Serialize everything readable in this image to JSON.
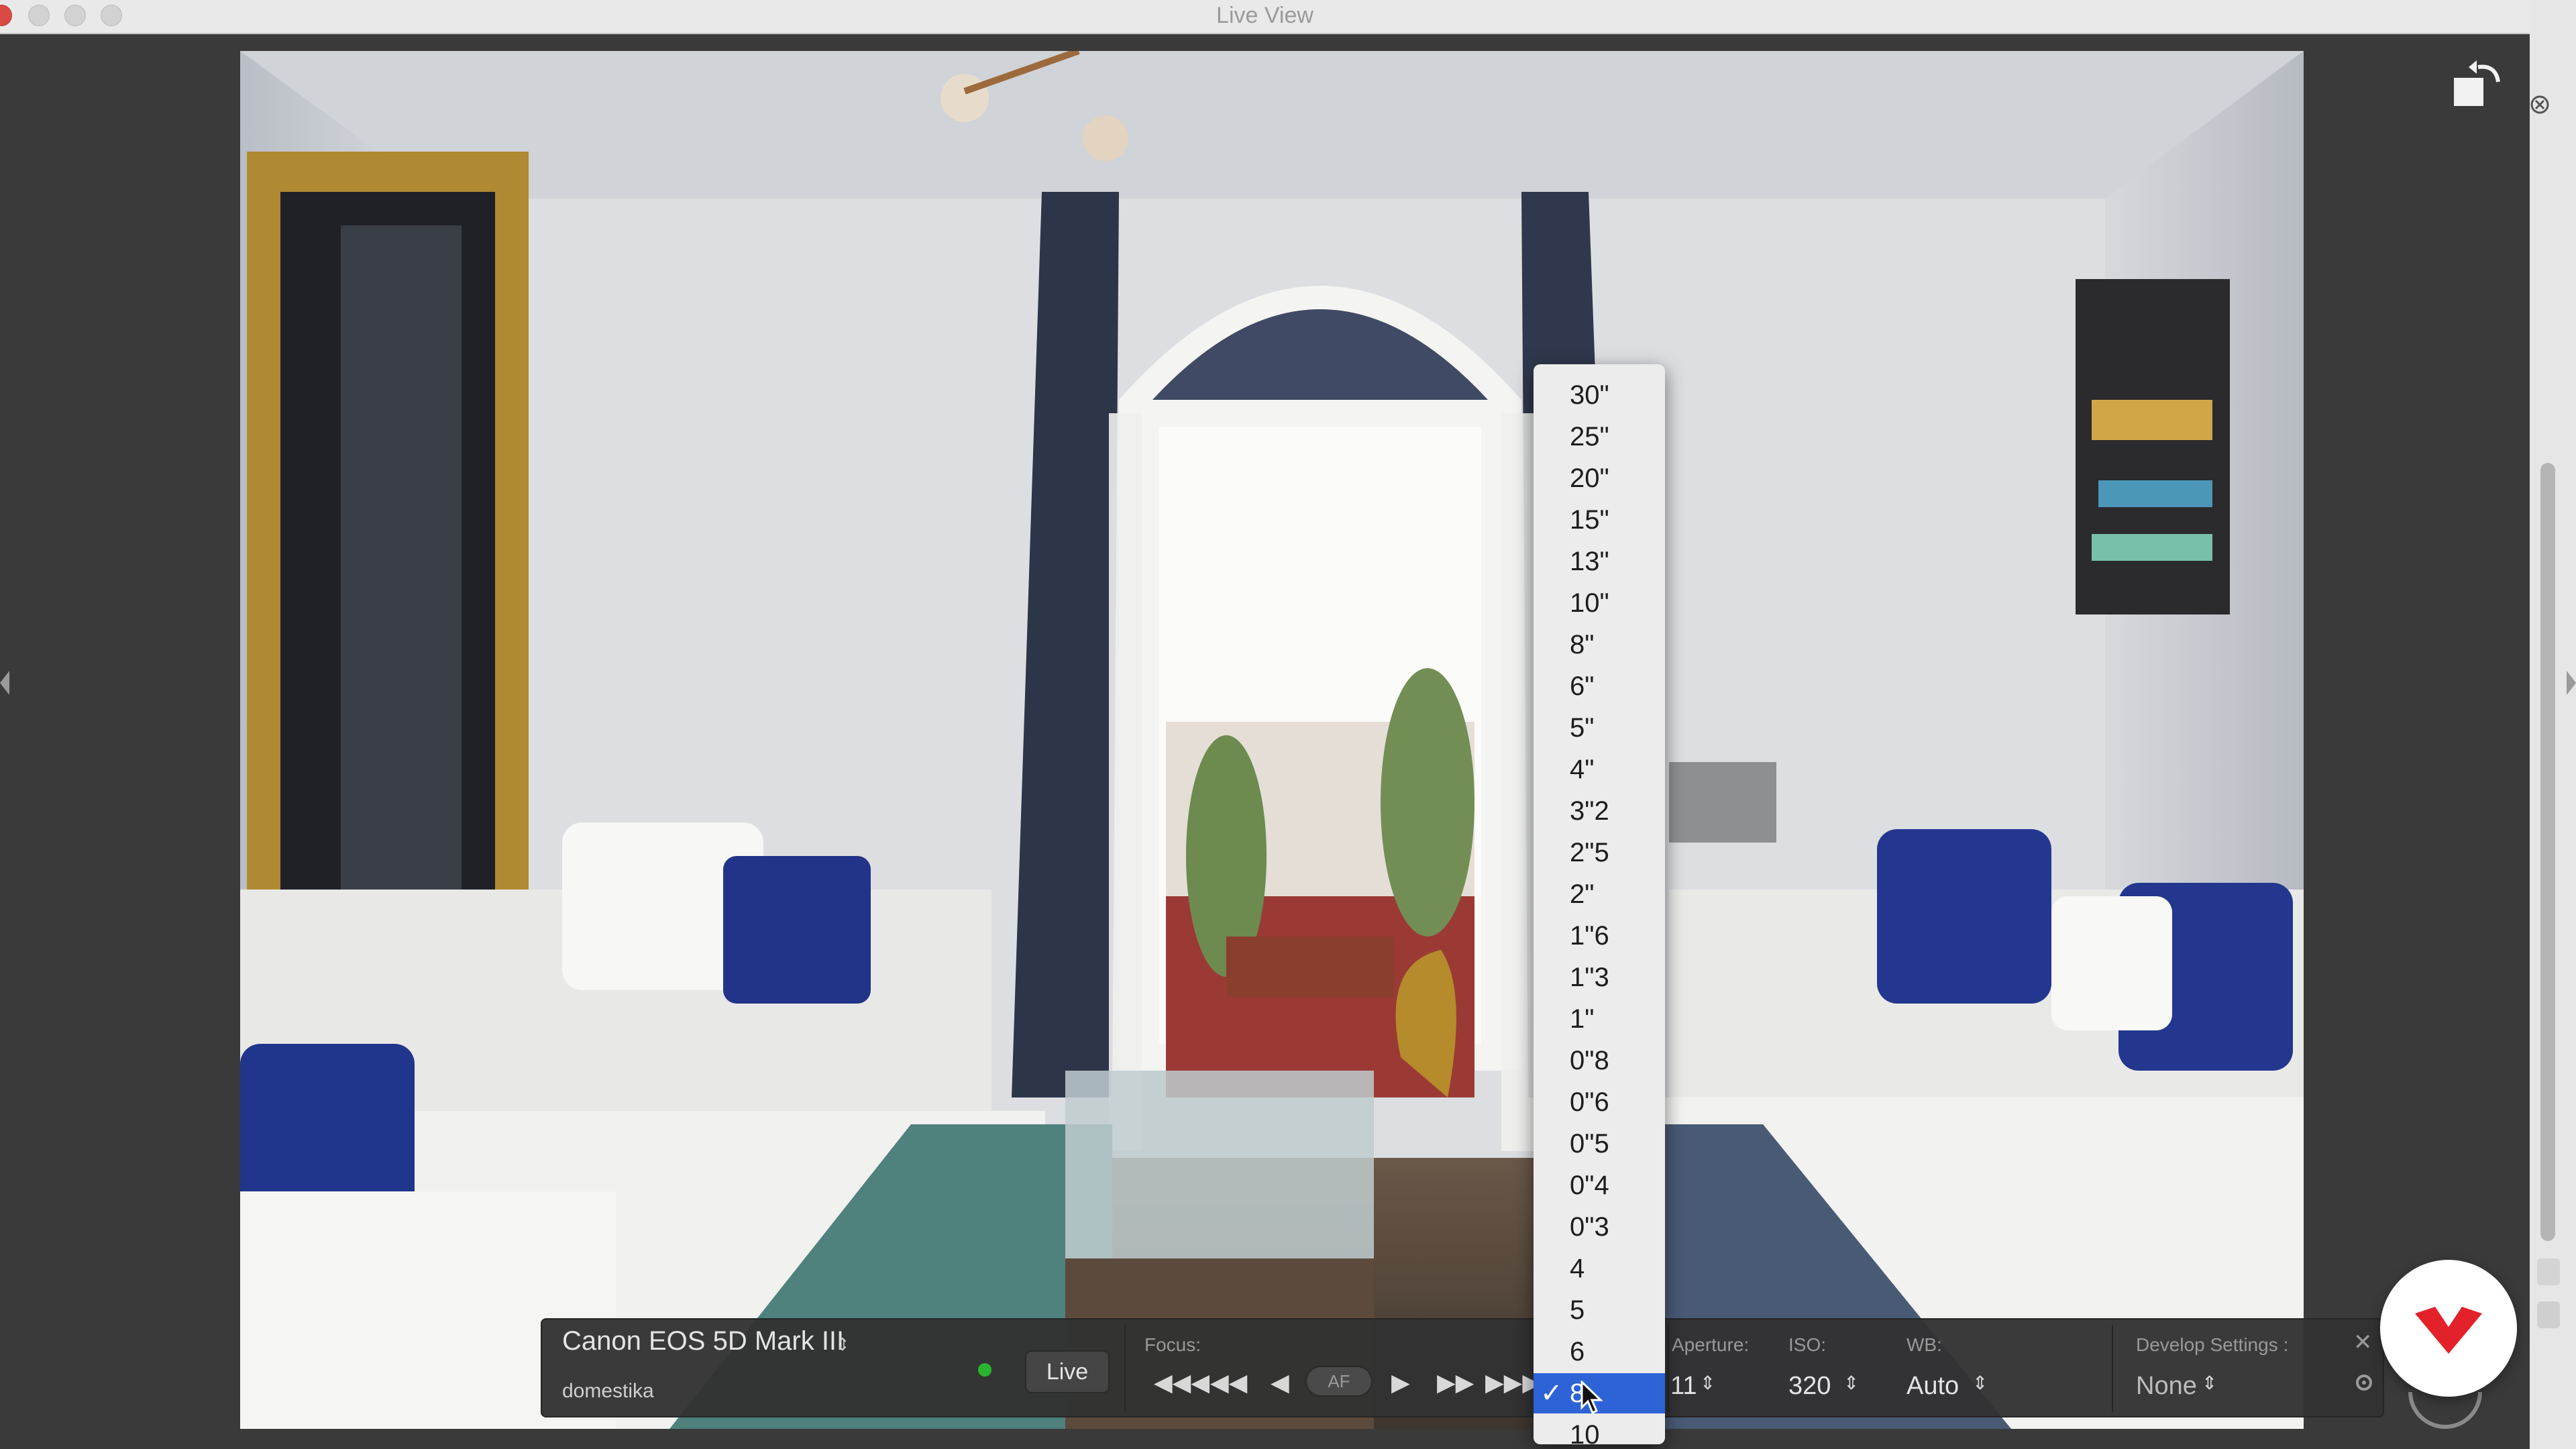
{
  "window": {
    "title": "Live View"
  },
  "toolbar": {
    "camera_name": "Canon EOS 5D Mark III",
    "session_name": "domestika",
    "live_label": "Live",
    "focus_label": "Focus:",
    "af_label": "AF",
    "aperture_label": "Aperture:",
    "aperture_value": "11",
    "iso_label": "ISO:",
    "iso_value": "320",
    "wb_label": "WB:",
    "wb_value": "Auto",
    "develop_label": "Develop Settings :",
    "develop_value": "None"
  },
  "shutter_menu": {
    "items": [
      "30\"",
      "25\"",
      "20\"",
      "15\"",
      "13\"",
      "10\"",
      "8\"",
      "6\"",
      "5\"",
      "4\"",
      "3\"2",
      "2\"5",
      "2\"",
      "1\"6",
      "1\"3",
      "1\"",
      "0\"8",
      "0\"6",
      "0\"5",
      "0\"4",
      "0\"3",
      "4",
      "5",
      "6",
      "8",
      "10"
    ],
    "selected": "8",
    "check_mark": "✓"
  },
  "colors": {
    "menu_selected": "#2e63d8",
    "status_on": "#29b52e",
    "logo_red": "#e3212b"
  },
  "icons": {
    "rotate": "rotate-icon",
    "close": "close-icon",
    "gear": "gear-icon",
    "cursor": "cursor-icon",
    "logo": "logo-icon"
  }
}
